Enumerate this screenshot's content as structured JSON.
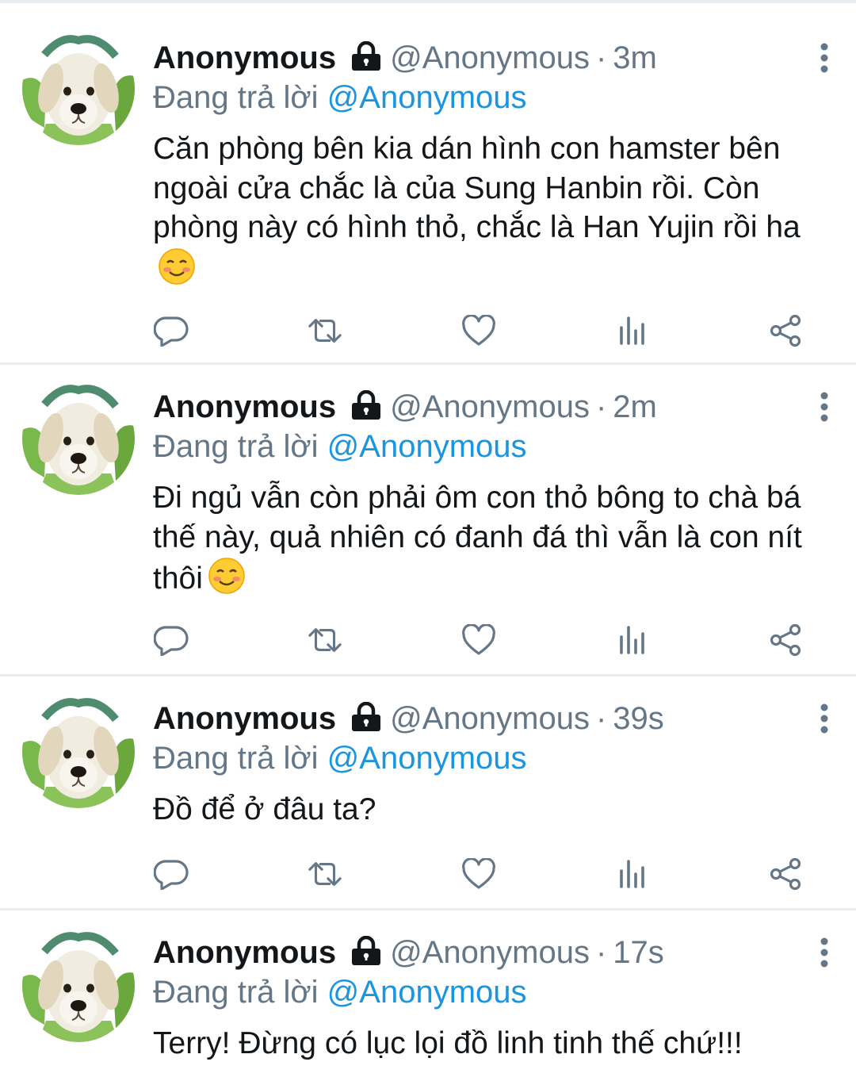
{
  "tweets": [
    {
      "name": "Anonymous",
      "handle": "@Anonymous",
      "separator": "·",
      "time": "3m",
      "reply_prefix": "Đang trả lời",
      "reply_to": "@Anonymous",
      "text": "Căn phòng bên kia dán hình con hamster bên ngoài cửa chắc là của Sung Hanbin rồi. Còn phòng này có hình thỏ, chắc là Han Yujin rồi ha",
      "emoji": "smiling-face-icon"
    },
    {
      "name": "Anonymous",
      "handle": "@Anonymous",
      "separator": "·",
      "time": "2m",
      "reply_prefix": "Đang trả lời",
      "reply_to": "@Anonymous",
      "text": "Đi ngủ vẫn còn phải ôm con thỏ bông to chà bá thế này, quả nhiên có đanh đá thì vẫn là con nít thôi",
      "emoji": "smiling-face-icon"
    },
    {
      "name": "Anonymous",
      "handle": "@Anonymous",
      "separator": "·",
      "time": "39s",
      "reply_prefix": "Đang trả lời",
      "reply_to": "@Anonymous",
      "text": "Đồ để ở đâu ta?"
    },
    {
      "name": "Anonymous",
      "handle": "@Anonymous",
      "separator": "·",
      "time": "17s",
      "reply_prefix": "Đang trả lời",
      "reply_to": "@Anonymous",
      "text": "Terry! Đừng có lục lọi đồ linh tinh thế chứ!!!"
    }
  ],
  "icons": [
    "lock-icon",
    "more-vertical-icon",
    "reply-icon",
    "retweet-icon",
    "like-icon",
    "analytics-icon",
    "share-icon"
  ],
  "colors": {
    "text": "#14171a",
    "secondary": "#657786",
    "link": "#1b95e0",
    "divider": "#e6ecf0"
  }
}
